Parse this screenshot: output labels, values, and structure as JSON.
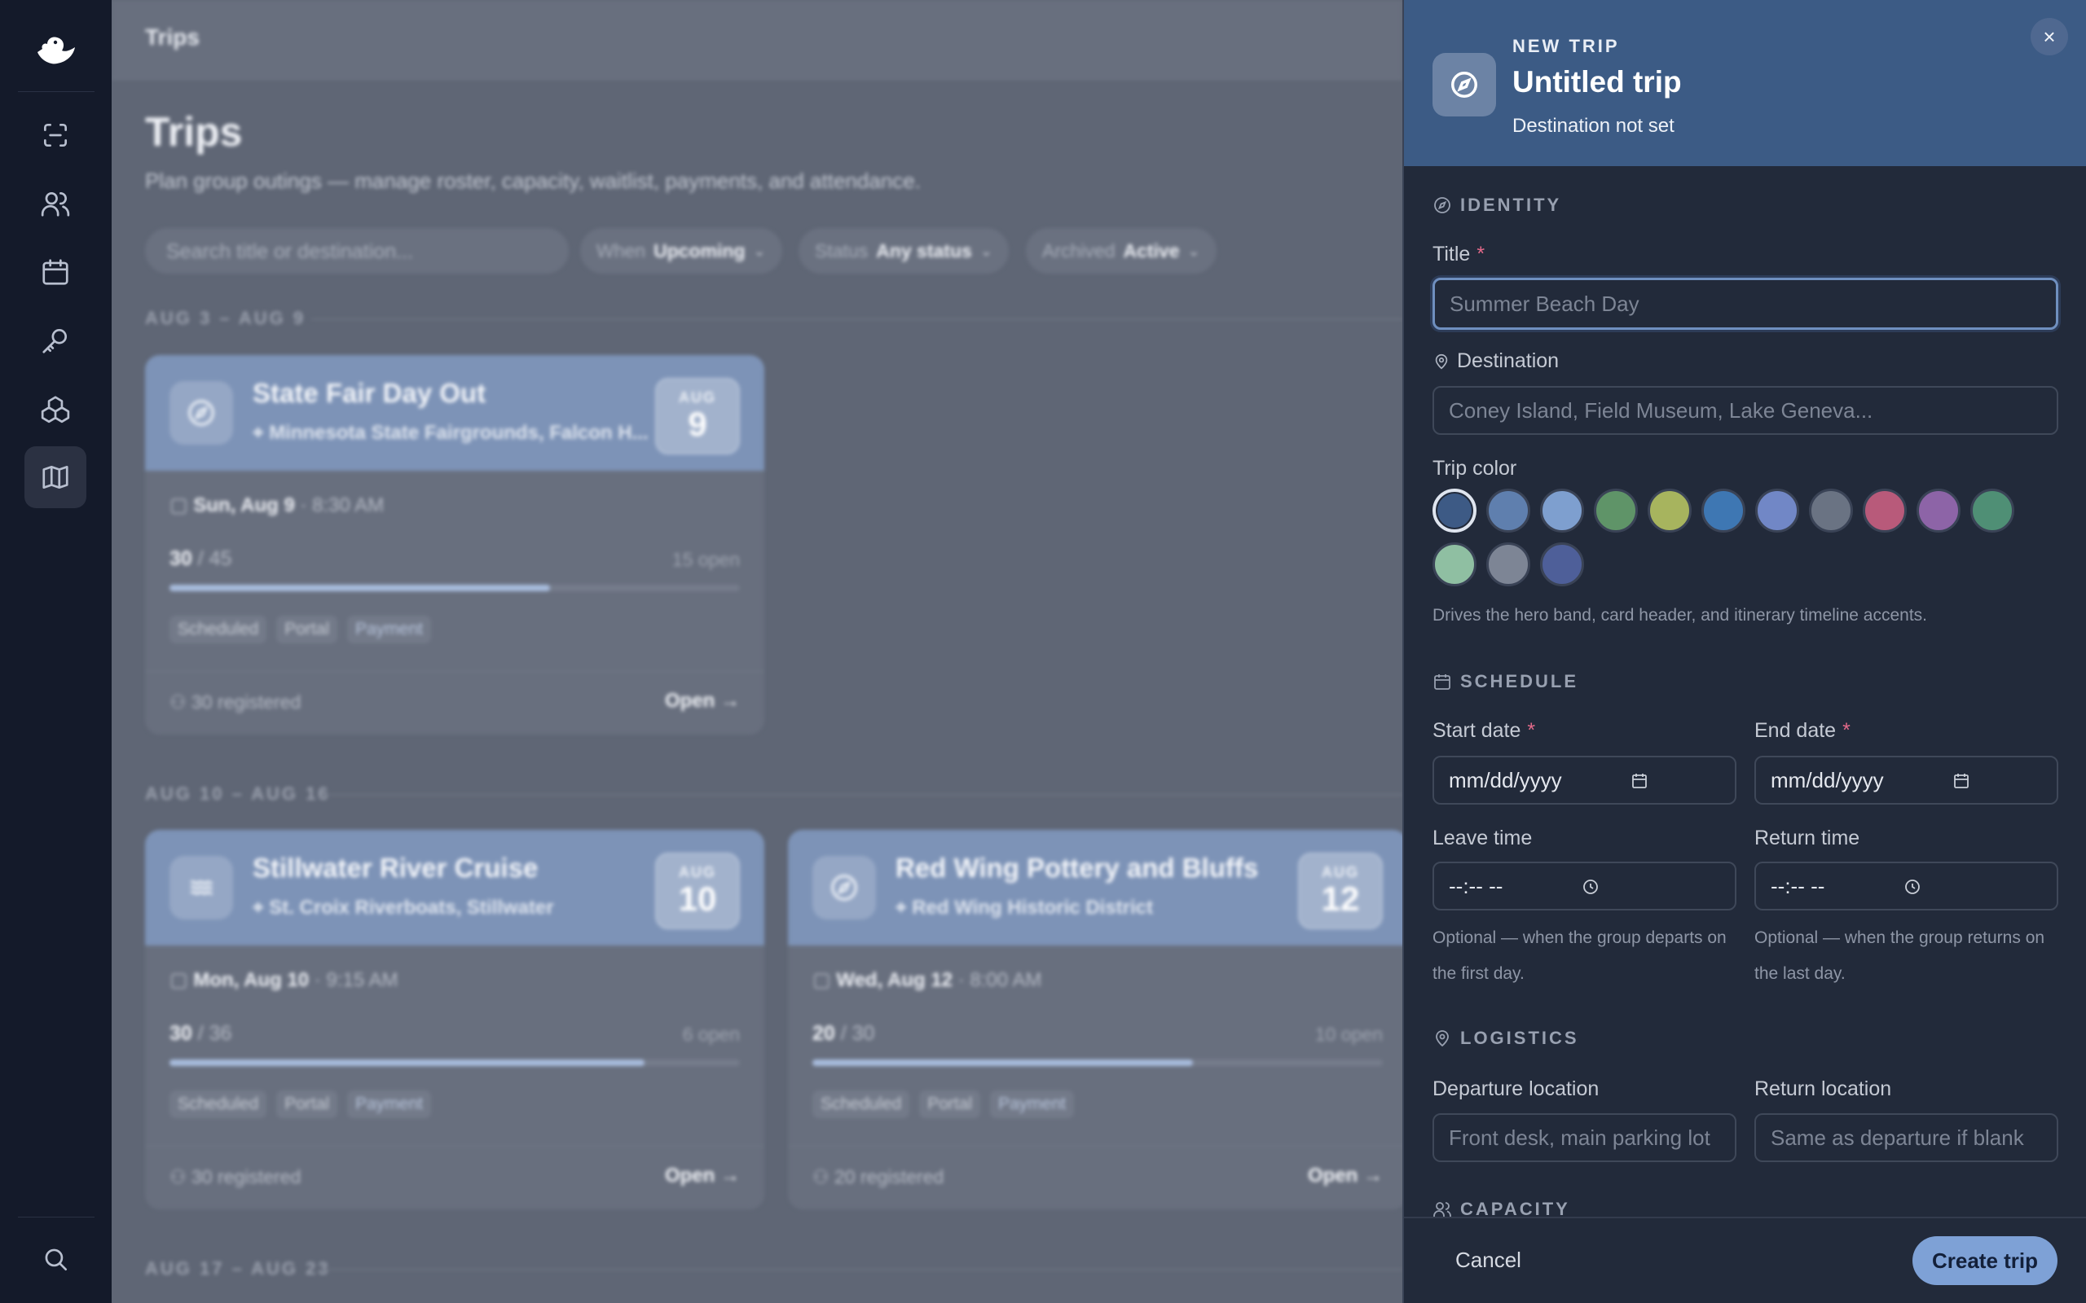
{
  "nav": {
    "items": [
      "scan",
      "people",
      "calendar",
      "key",
      "boxes",
      "map"
    ],
    "active": "map",
    "bottom": "search"
  },
  "page": {
    "topbar_title": "Trips",
    "title": "Trips",
    "subtitle": "Plan group outings — manage roster, capacity, waitlist, payments, and attendance.",
    "search_placeholder": "Search title or destination...",
    "filters": [
      {
        "label": "When",
        "value": "Upcoming"
      },
      {
        "label": "Status",
        "value": "Any status"
      },
      {
        "label": "Archived",
        "value": "Active"
      }
    ],
    "weeks": [
      "AUG 3 – AUG 9",
      "AUG 10 – AUG 16",
      "AUG 17 – AUG 23"
    ]
  },
  "trips": [
    {
      "title": "State Fair Day Out",
      "location": "Minnesota State Fairgrounds, Falcon H...",
      "month": "AUG",
      "day": "9",
      "date": "Sun, Aug 9",
      "time": "8:30 AM",
      "registered": "30",
      "capacity": "/ 45",
      "open": "15 open",
      "fill": 0.667,
      "tags": [
        "Scheduled",
        "Portal",
        "Payment"
      ],
      "footer": "30 registered",
      "open_label": "Open",
      "icon": "compass"
    },
    {
      "title": "Stillwater River Cruise",
      "location": "St. Croix Riverboats, Stillwater",
      "month": "AUG",
      "day": "10",
      "date": "Mon, Aug 10",
      "time": "9:15 AM",
      "registered": "30",
      "capacity": "/ 36",
      "open": "6 open",
      "fill": 0.833,
      "tags": [
        "Scheduled",
        "Portal",
        "Payment"
      ],
      "footer": "30 registered",
      "open_label": "Open",
      "icon": "waves"
    },
    {
      "title": "Red Wing Pottery and Bluffs",
      "location": "Red Wing Historic District",
      "month": "AUG",
      "day": "12",
      "date": "Wed, Aug 12",
      "time": "8:00 AM",
      "registered": "20",
      "capacity": "/ 30",
      "open": "10 open",
      "fill": 0.667,
      "tags": [
        "Scheduled",
        "Portal",
        "Payment"
      ],
      "footer": "20 registered",
      "open_label": "Open",
      "icon": "compass"
    }
  ],
  "panel": {
    "kicker": "NEW TRIP",
    "title": "Untitled trip",
    "subtitle": "Destination not set",
    "close": "×",
    "sections": {
      "identity": "IDENTITY",
      "schedule": "SCHEDULE",
      "logistics": "LOGISTICS",
      "capacity": "CAPACITY"
    },
    "title_label": "Title",
    "title_placeholder": "Summer Beach Day",
    "destination_label": "Destination",
    "destination_placeholder": "Coney Island, Field Museum, Lake Geneva...",
    "color_label": "Trip color",
    "colors": [
      "#3d5a85",
      "#5f7fae",
      "#7e9fcf",
      "#5f9468",
      "#a7b45e",
      "#3e77b3",
      "#7187c6",
      "#6a7383",
      "#b85a7a",
      "#8d64a7",
      "#4f8f75",
      "#8fbfa2",
      "#7d8595",
      "#4e5f99"
    ],
    "color_help": "Drives the hero band, card header, and itinerary timeline accents.",
    "start_label": "Start date",
    "end_label": "End date",
    "date_placeholder": "mm/dd/yyyy",
    "leave_label": "Leave time",
    "return_label": "Return time",
    "time_placeholder": "--:-- --",
    "leave_help": "Optional — when the group departs on the first day.",
    "return_help": "Optional — when the group returns on the last day.",
    "departure_label": "Departure location",
    "departure_placeholder": "Front desk, main parking lot",
    "return_loc_label": "Return location",
    "return_loc_placeholder": "Same as departure if blank",
    "cancel": "Cancel",
    "create": "Create trip"
  }
}
